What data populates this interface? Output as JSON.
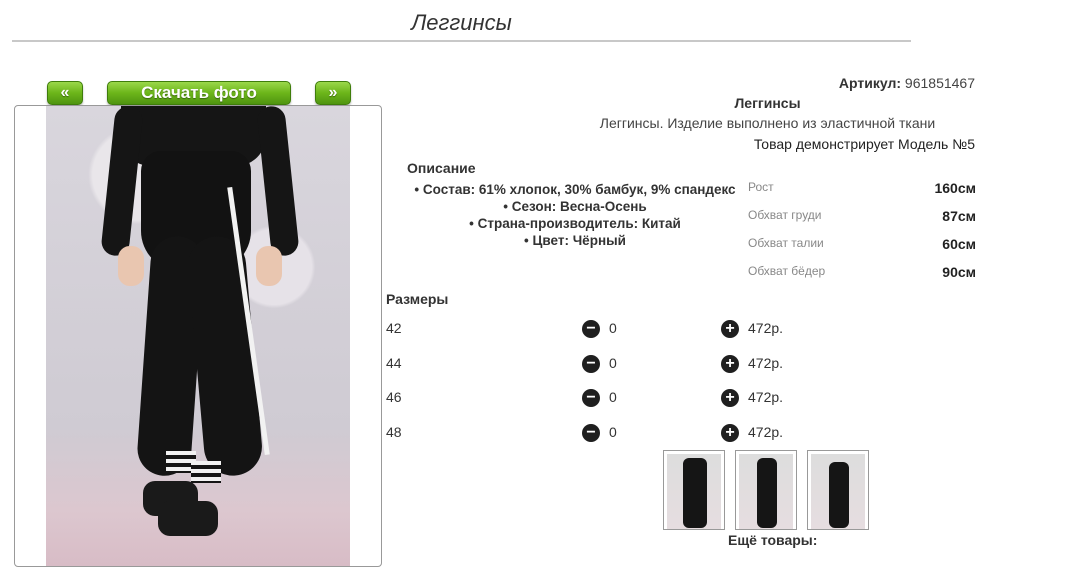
{
  "page": {
    "title": "Леггинсы"
  },
  "gallery": {
    "prev_label": "«",
    "download_label": "Скачать фото",
    "next_label": "»"
  },
  "product": {
    "article_label": "Артикул:",
    "article_value": "961851467",
    "name": "Леггинсы",
    "short_description": "Леггинсы. Изделие выполнено из эластичной ткани",
    "model_note": "Товар демонстрирует Модель №5"
  },
  "description": {
    "heading": "Описание",
    "items": [
      "Состав: 61% хлопок, 30% бамбук, 9% спандекс",
      "Сезон: Весна-Осень",
      "Страна-производитель: Китай",
      "Цвет: Чёрный"
    ]
  },
  "measurements": [
    {
      "label": "Рост",
      "value": "160см"
    },
    {
      "label": "Обхват груди",
      "value": "87см"
    },
    {
      "label": "Обхват талии",
      "value": "60см"
    },
    {
      "label": "Обхват бёдер",
      "value": "90см"
    }
  ],
  "sizes": {
    "heading": "Размеры",
    "rows": [
      {
        "size": "42",
        "qty": "0",
        "price": "472р."
      },
      {
        "size": "44",
        "qty": "0",
        "price": "472р."
      },
      {
        "size": "46",
        "qty": "0",
        "price": "472р."
      },
      {
        "size": "48",
        "qty": "0",
        "price": "472р."
      }
    ]
  },
  "more_label": "Ещё товары:",
  "icons": {
    "minus": "minus-circle-icon",
    "plus": "plus-circle-icon"
  },
  "colors": {
    "button_green": "#6cb51a",
    "bullet": "#333333"
  }
}
